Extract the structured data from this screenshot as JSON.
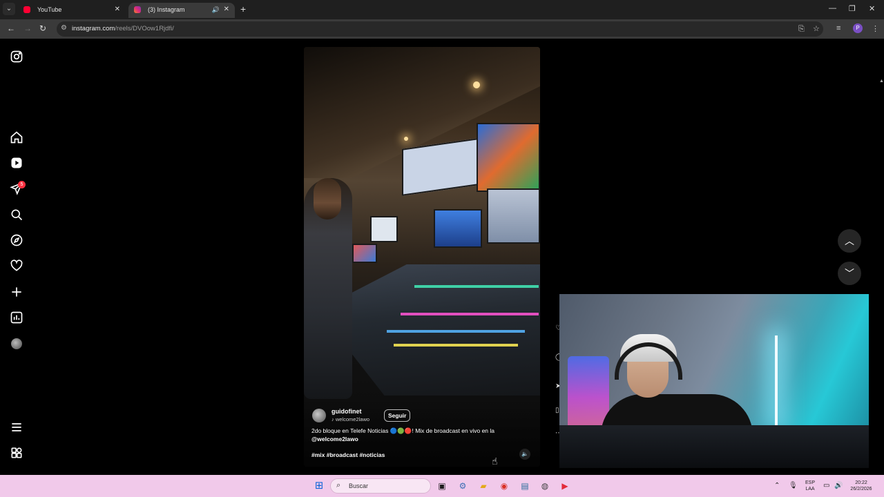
{
  "browser": {
    "tabs": [
      {
        "label": "YouTube",
        "favicon_color": "#ff0033"
      },
      {
        "label": "(3) Instagram",
        "favicon_color": "#e1306c"
      }
    ],
    "url_host": "instagram.com",
    "url_path": "/reels/DVOow1Rjdfi/",
    "profile_initial": "P"
  },
  "instagram": {
    "notification_badge": "5",
    "reel": {
      "author": "guidofinet",
      "author_sub": "welcome2lawo",
      "follow_label": "Seguir",
      "caption_text": "2do bloque en Telefe Noticias 🔵🟢🔴! Mix de broadcast en vivo en la",
      "caption_mention": "@welcome2lawo",
      "hashtags": "#mix #broadcast #noticias"
    }
  },
  "taskbar": {
    "search_placeholder": "Buscar",
    "lang_top": "ESP",
    "lang_bottom": "LAA",
    "time": "20:22",
    "date": "26/2/2026"
  },
  "colors": {
    "taskbar_bg": "#f1c9ea",
    "ig_badge": "#ff3040",
    "page_bg": "#000000"
  }
}
